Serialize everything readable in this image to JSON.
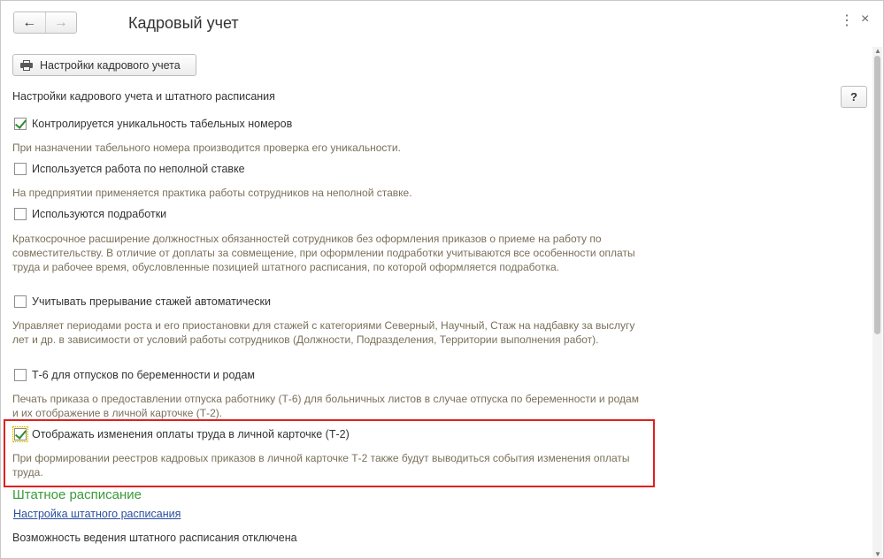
{
  "window": {
    "title": "Кадровый учет",
    "nav_back_icon": "←",
    "nav_forward_icon": "→",
    "menu_icon": "⋮",
    "close_icon": "×"
  },
  "toolbar": {
    "settings_button_label": "Настройки кадрового учета",
    "help_label": "?"
  },
  "section": {
    "title": "Настройки кадрового учета и штатного расписания"
  },
  "options": [
    {
      "label": "Контролируется уникальность табельных номеров",
      "checked": true,
      "description": "При назначении табельного номера производится проверка его уникальности."
    },
    {
      "label": "Используется работа по неполной ставке",
      "checked": false,
      "description": "На предприятии применяется практика работы сотрудников на неполной ставке."
    },
    {
      "label": "Используются подработки",
      "checked": false,
      "description": "Краткосрочное расширение должностных обязанностей сотрудников без оформления приказов о приеме на работу по совместительству. В отличие от доплаты за совмещение, при оформлении подработки учитываются все особенности оплаты труда и рабочее время, обусловленные позицией штатного расписания, по которой оформляется подработка."
    },
    {
      "label": "Учитывать прерывание стажей автоматически",
      "checked": false,
      "description": "Управляет периодами роста и его приостановки для стажей с категориями Северный, Научный, Стаж на надбавку за выслугу лет и др. в зависимости от условий работы сотрудников (Должности, Подразделения, Территории выполнения работ)."
    },
    {
      "label": "Т-6 для отпусков по беременности и родам",
      "checked": false,
      "description": "Печать приказа о предоставлении отпуска работнику (Т-6) для больничных листов в случае отпуска по беременности и родам и их отображение в личной карточке (Т-2)."
    },
    {
      "label": "Отображать изменения оплаты труда в личной карточке (Т-2)",
      "checked": true,
      "description": "При формировании реестров кадровых приказов в личной карточке Т-2 также будут выводиться события изменения оплаты труда."
    }
  ],
  "staffing": {
    "title": "Штатное расписание",
    "link": "Настройка штатного расписания",
    "info": "Возможность ведения штатного расписания отключена"
  },
  "colors": {
    "highlight": "#e0201f",
    "section_green": "#3b9a3b",
    "link_blue": "#2a4fa0",
    "description": "#7a6f5a"
  }
}
